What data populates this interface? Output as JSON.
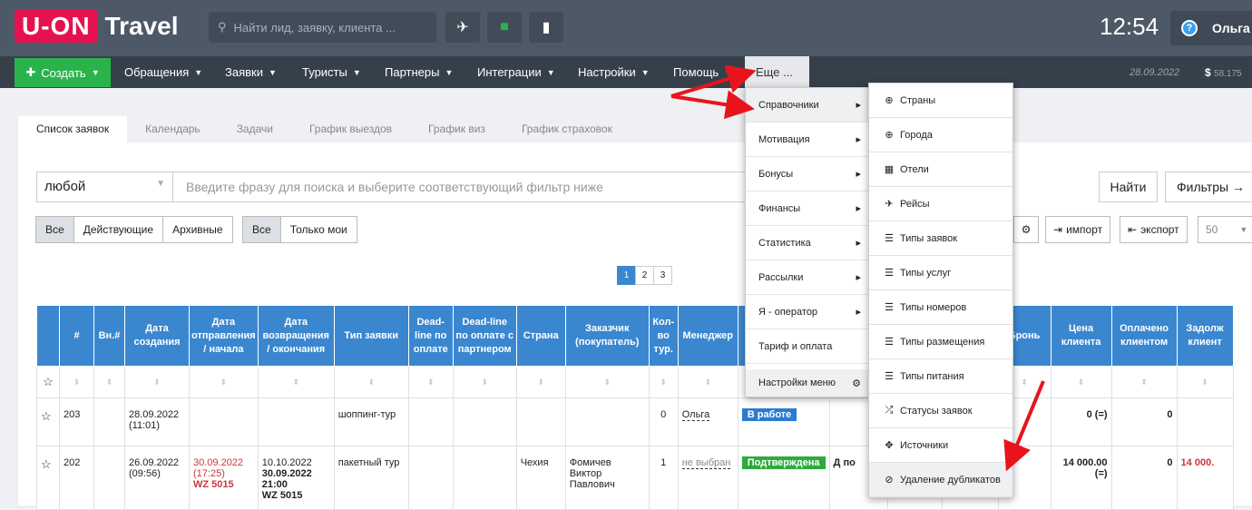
{
  "logo": {
    "box": "U-ON",
    "text": "Travel"
  },
  "search": {
    "placeholder": "Найти лид, заявку, клиента ..."
  },
  "clock": "12:54",
  "user": {
    "name": "Ольга"
  },
  "menu": {
    "create": "Создать",
    "items": [
      "Обращения",
      "Заявки",
      "Туристы",
      "Партнеры",
      "Интеграции",
      "Настройки",
      "Помощь"
    ],
    "more": "Еще ..."
  },
  "date": "28.09.2022",
  "balance": "58.175",
  "tabs": [
    "Список заявок",
    "Календарь",
    "Задачи",
    "График выездов",
    "График виз",
    "График страховок"
  ],
  "filter": {
    "select": "любой",
    "query_placeholder": "Введите фразу для поиска и выберите соответствующий фильтр ниже",
    "find": "Найти",
    "filters": "Фильтры →"
  },
  "group1": [
    "Все",
    "Действующие",
    "Архивные"
  ],
  "group2": [
    "Все",
    "Только мои"
  ],
  "import": "импорт",
  "export": "экспорт",
  "perpage": "50",
  "pages": [
    "1",
    "2",
    "3"
  ],
  "headers": [
    "#",
    "Вн.#",
    "Дата создания",
    "Дата отправления / начала",
    "Дата возвращения / окончания",
    "Тип заявки",
    "Dead-line по оплате",
    "Dead-line по оплате с партнером",
    "Страна",
    "Заказчик (покупатель)",
    "Кол-во тур.",
    "Менеджер",
    "",
    "",
    "",
    "",
    "Бронь",
    "Цена клиента",
    "Оплачено клиентом",
    "Задолж клиент"
  ],
  "rows": [
    {
      "num": "203",
      "created": "28.09.2022",
      "created_time": "(11:01)",
      "type": "шоппинг-тур",
      "qty": "0",
      "manager": "Ольга",
      "status": "В работе",
      "price": "0 (=)",
      "paid": "0"
    },
    {
      "num": "202",
      "created": "26.09.2022",
      "created_time": "(09:56)",
      "dep": "30.09.2022",
      "dep_time": "(17:25)",
      "dep_flight": "WZ 5015",
      "ret": "10.10.2022",
      "ret2": "30.09.2022",
      "ret2_time": "21:00",
      "ret_flight": "WZ 5015",
      "type": "пакетный тур",
      "country": "Чехия",
      "customer": "Фомичев Виктор Павлович",
      "qty": "1",
      "manager": "не выбран",
      "status": "Подтверждена",
      "extra": "Д по",
      "price": "14 000.00 (=)",
      "paid": "0",
      "debt": "14 000."
    }
  ],
  "dropdown": {
    "items": [
      "Справочники",
      "Мотивация",
      "Бонусы",
      "Финансы",
      "Статистика",
      "Рассылки",
      "Я - оператор",
      "Тариф и оплата"
    ],
    "settings": "Настройки меню"
  },
  "submenu": [
    {
      "label": "Страны",
      "icon": "globe-icon"
    },
    {
      "label": "Города",
      "icon": "globe-icon"
    },
    {
      "label": "Отели",
      "icon": "building-icon"
    },
    {
      "label": "Рейсы",
      "icon": "plane-icon"
    },
    {
      "label": "Типы заявок",
      "icon": "list-icon"
    },
    {
      "label": "Типы услуг",
      "icon": "list-icon"
    },
    {
      "label": "Типы номеров",
      "icon": "list-icon"
    },
    {
      "label": "Типы размещения",
      "icon": "list-icon"
    },
    {
      "label": "Типы питания",
      "icon": "list-icon"
    },
    {
      "label": "Статусы заявок",
      "icon": "shuffle-icon"
    },
    {
      "label": "Источники",
      "icon": "arrows-icon"
    },
    {
      "label": "Удаление дубликатов",
      "icon": "ban-icon"
    }
  ]
}
